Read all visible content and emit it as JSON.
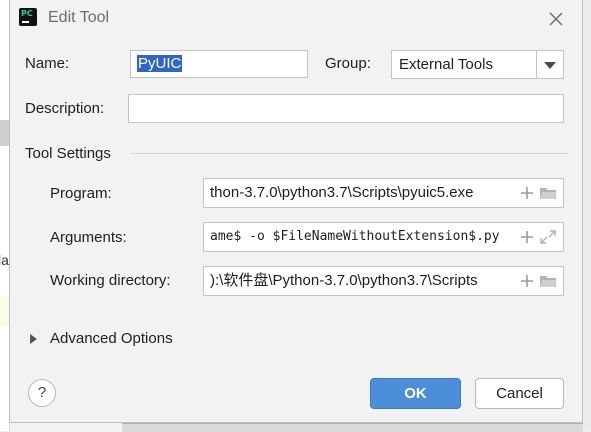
{
  "background": {
    "left_text": "la"
  },
  "dialog": {
    "title": "Edit Tool",
    "app_icon": "pycharm-logo",
    "app_icon_text": "PC",
    "close_icon": "close-icon"
  },
  "form": {
    "name_label": "Name:",
    "name_value": "PyUIC",
    "group_label": "Group:",
    "group_value": "External Tools",
    "description_label": "Description:",
    "description_value": ""
  },
  "tool_settings": {
    "title": "Tool Settings",
    "program_label": "Program:",
    "program_value": "thon-3.7.0\\python3.7\\Scripts\\pyuic5.exe",
    "arguments_label": "Arguments:",
    "arguments_value": "ame$ -o $FileNameWithoutExtension$.py",
    "working_dir_label": "Working directory:",
    "working_dir_value": "):\\软件盘\\Python-3.7.0\\python3.7\\Scripts"
  },
  "advanced": {
    "label": "Advanced Options"
  },
  "buttons": {
    "help": "?",
    "ok": "OK",
    "cancel": "Cancel"
  },
  "colors": {
    "accent": "#4b8fd9",
    "selection": "#2f65ca"
  }
}
